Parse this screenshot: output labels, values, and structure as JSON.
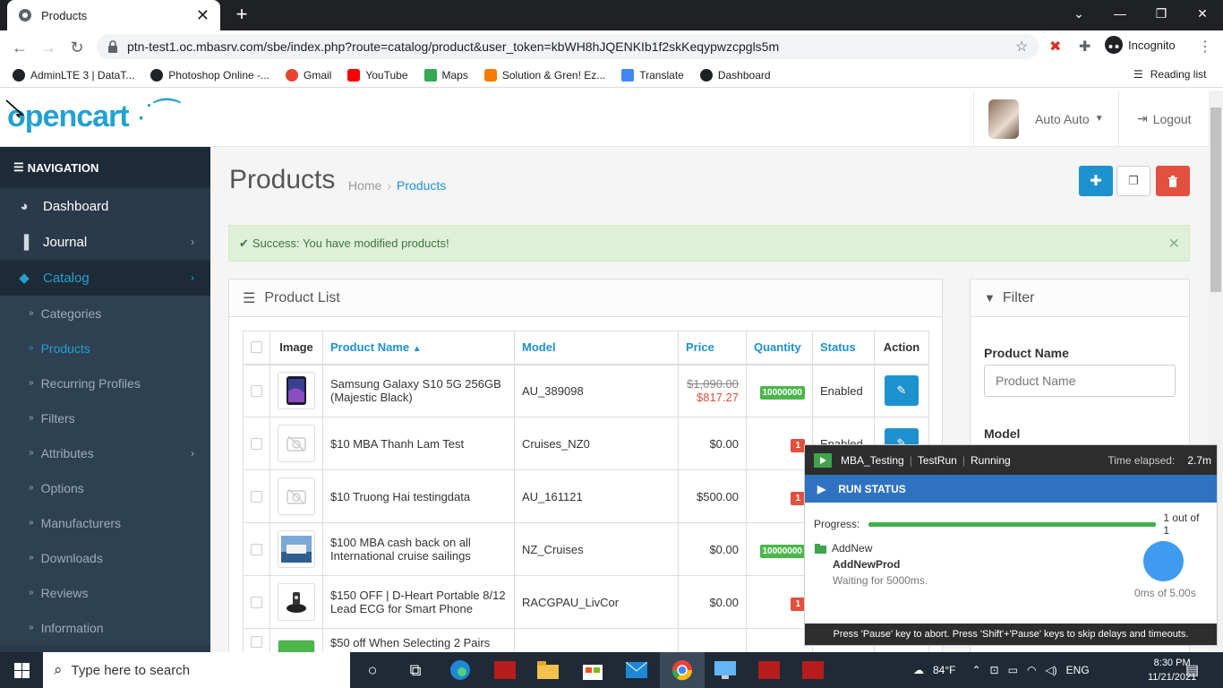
{
  "browser": {
    "tab_title": "Products",
    "url": "ptn-test1.oc.mbasrv.com/sbe/index.php?route=catalog/product&user_token=kbWH8hJQENKIb1f2skKeqypwzcpgls5m",
    "profile_label": "Incognito",
    "bookmarks": [
      {
        "label": "AdminLTE 3 | DataT...",
        "color": "#202124"
      },
      {
        "label": "Photoshop Online -...",
        "color": "#202124"
      },
      {
        "label": "Gmail",
        "color": "#ea4335"
      },
      {
        "label": "YouTube",
        "color": "#ff0000"
      },
      {
        "label": "Maps",
        "color": "#34a853"
      },
      {
        "label": "Solution & Gren! Ez...",
        "color": "#f57c00"
      },
      {
        "label": "Translate",
        "color": "#4285f4"
      },
      {
        "label": "Dashboard",
        "color": "#202124"
      }
    ],
    "reading_list": "Reading list"
  },
  "header": {
    "logo_text": "opencart",
    "user_name": "Auto Auto",
    "logout": "Logout"
  },
  "sidebar": {
    "title": "NAVIGATION",
    "items": [
      {
        "label": "Dashboard",
        "icon": "dashboard-icon"
      },
      {
        "label": "Journal",
        "icon": "journal-icon"
      },
      {
        "label": "Catalog",
        "icon": "tags-icon"
      }
    ],
    "subitems": [
      "Categories",
      "Products",
      "Recurring Profiles",
      "Filters",
      "Attributes",
      "Options",
      "Manufacturers",
      "Downloads",
      "Reviews",
      "Information"
    ]
  },
  "page": {
    "title": "Products",
    "breadcrumb_home": "Home",
    "breadcrumb_current": "Products",
    "alert": "Success: You have modified products!"
  },
  "product_list": {
    "title": "Product List",
    "columns": {
      "image": "Image",
      "name": "Product Name",
      "model": "Model",
      "price": "Price",
      "quantity": "Quantity",
      "status": "Status",
      "action": "Action"
    },
    "rows": [
      {
        "name": "Samsung Galaxy S10 5G 256GB (Majestic Black)",
        "model": "AU_389098",
        "price_old": "$1,090.00",
        "price": "$817.27",
        "quantity": "10000000",
        "status": "Enabled"
      },
      {
        "name": "$10 MBA Thanh Lam Test",
        "model": "Cruises_NZ0",
        "price_old": "",
        "price": "$0.00",
        "quantity": "1",
        "status": "Enabled"
      },
      {
        "name": "$10 Truong Hai testingdata",
        "model": "AU_161121",
        "price_old": "",
        "price": "$500.00",
        "quantity": "1",
        "status": ""
      },
      {
        "name": "$100 MBA cash back on all International cruise sailings",
        "model": "NZ_Cruises",
        "price_old": "",
        "price": "$0.00",
        "quantity": "10000000",
        "status": ""
      },
      {
        "name": "$150 OFF | D-Heart Portable 8/12 Lead ECG for Smart Phone",
        "model": "RACGPAU_LivCor",
        "price_old": "",
        "price": "$0.00",
        "quantity": "1",
        "status": ""
      },
      {
        "name": "$50 off When Selecting 2 Pairs",
        "model": "",
        "price_old": "",
        "price": "",
        "quantity": "",
        "status": ""
      }
    ]
  },
  "filter": {
    "title": "Filter",
    "product_name_label": "Product Name",
    "product_name_placeholder": "Product Name",
    "model_label": "Model"
  },
  "runner": {
    "project": "MBA_Testing",
    "mode": "TestRun",
    "state": "Running",
    "elapsed_label": "Time elapsed:",
    "elapsed_value": "2.7m",
    "run_status": "RUN STATUS",
    "progress_label": "Progress:",
    "progress_value": "1 out of 1",
    "progress_fraction": 1.0,
    "step_group": "AddNew",
    "step_name": "AddNewProd",
    "step_status": "Waiting for 5000ms.",
    "timer": "0ms of 5.00s",
    "footer": "Press 'Pause' key to abort. Press 'Shift'+'Pause' keys to skip delays and timeouts."
  },
  "taskbar": {
    "search_placeholder": "Type here to search",
    "temperature": "84°F",
    "language": "ENG",
    "time": "8:30 PM",
    "date": "11/21/2021"
  }
}
